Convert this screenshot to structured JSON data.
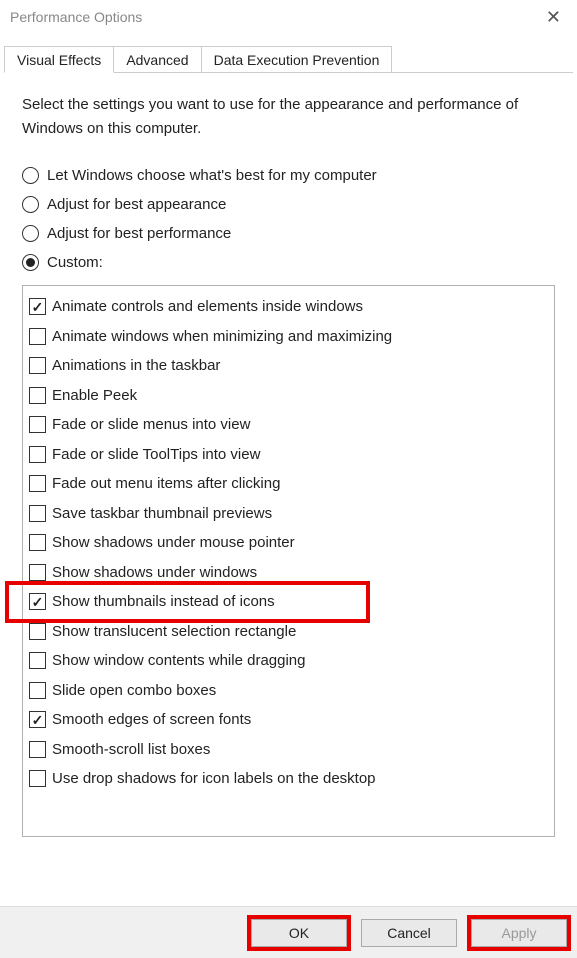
{
  "window": {
    "title": "Performance Options"
  },
  "tabs": [
    {
      "label": "Visual Effects",
      "active": true
    },
    {
      "label": "Advanced",
      "active": false
    },
    {
      "label": "Data Execution Prevention",
      "active": false
    }
  ],
  "intro": "Select the settings you want to use for the appearance and performance of Windows on this computer.",
  "radios": [
    {
      "label": "Let Windows choose what's best for my computer",
      "checked": false
    },
    {
      "label": "Adjust for best appearance",
      "checked": false
    },
    {
      "label": "Adjust for best performance",
      "checked": false
    },
    {
      "label": "Custom:",
      "checked": true
    }
  ],
  "checks": [
    {
      "label": "Animate controls and elements inside windows",
      "checked": true,
      "highlight": false
    },
    {
      "label": "Animate windows when minimizing and maximizing",
      "checked": false,
      "highlight": false
    },
    {
      "label": "Animations in the taskbar",
      "checked": false,
      "highlight": false
    },
    {
      "label": "Enable Peek",
      "checked": false,
      "highlight": false
    },
    {
      "label": "Fade or slide menus into view",
      "checked": false,
      "highlight": false
    },
    {
      "label": "Fade or slide ToolTips into view",
      "checked": false,
      "highlight": false
    },
    {
      "label": "Fade out menu items after clicking",
      "checked": false,
      "highlight": false
    },
    {
      "label": "Save taskbar thumbnail previews",
      "checked": false,
      "highlight": false
    },
    {
      "label": "Show shadows under mouse pointer",
      "checked": false,
      "highlight": false
    },
    {
      "label": "Show shadows under windows",
      "checked": false,
      "highlight": false
    },
    {
      "label": "Show thumbnails instead of icons",
      "checked": true,
      "highlight": true
    },
    {
      "label": "Show translucent selection rectangle",
      "checked": false,
      "highlight": false
    },
    {
      "label": "Show window contents while dragging",
      "checked": false,
      "highlight": false
    },
    {
      "label": "Slide open combo boxes",
      "checked": false,
      "highlight": false
    },
    {
      "label": "Smooth edges of screen fonts",
      "checked": true,
      "highlight": false
    },
    {
      "label": "Smooth-scroll list boxes",
      "checked": false,
      "highlight": false
    },
    {
      "label": "Use drop shadows for icon labels on the desktop",
      "checked": false,
      "highlight": false
    }
  ],
  "buttons": {
    "ok": "OK",
    "cancel": "Cancel",
    "apply": "Apply"
  }
}
